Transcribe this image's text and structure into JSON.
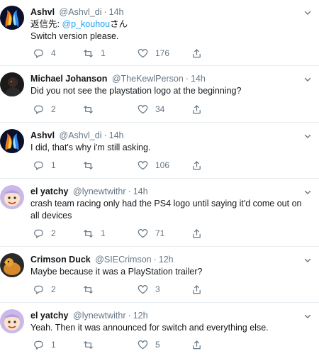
{
  "colors": {
    "link": "#1da1f2",
    "secondary_text": "#657786",
    "primary_text": "#14171a",
    "divider": "#e6ecf0"
  },
  "tweets": [
    {
      "avatar": "fire-ice-avatar",
      "name": "Ashvl",
      "handle": "@Ashvl_di",
      "dot": "·",
      "time": "14h",
      "reply_prefix": "返信先: ",
      "reply_handle": "@p_kouhou",
      "reply_suffix": "さん",
      "text": "Switch version please.",
      "replies": "4",
      "retweets": "1",
      "likes": "176"
    },
    {
      "avatar": "dark-portrait-avatar",
      "name": "Michael Johanson",
      "handle": "@TheKewlPerson",
      "dot": "·",
      "time": "14h",
      "text": "Did you not see the playstation logo at the beginning?",
      "replies": "2",
      "retweets": "",
      "likes": "34"
    },
    {
      "avatar": "fire-ice-avatar",
      "name": "Ashvl",
      "handle": "@Ashvl_di",
      "dot": "·",
      "time": "14h",
      "text": "I did, that's why i'm still asking.",
      "replies": "1",
      "retweets": "",
      "likes": "106"
    },
    {
      "avatar": "cartoon-face-avatar",
      "name": "el yatchy",
      "handle": "@lynewtwithr",
      "dot": "·",
      "time": "14h",
      "text": "crash team racing only had the PS4 logo until saying it'd come out on all devices",
      "replies": "2",
      "retweets": "1",
      "likes": "71"
    },
    {
      "avatar": "duck-avatar",
      "name": "Crimson Duck",
      "handle": "@SIECrimson",
      "dot": "·",
      "time": "12h",
      "text": "Maybe because it was a PlayStation trailer?",
      "replies": "2",
      "retweets": "",
      "likes": "3"
    },
    {
      "avatar": "cartoon-face-avatar",
      "name": "el yatchy",
      "handle": "@lynewtwithr",
      "dot": "·",
      "time": "12h",
      "text": "Yeah. Then it was announced for switch and everything else.",
      "replies": "1",
      "retweets": "",
      "likes": "5"
    }
  ]
}
